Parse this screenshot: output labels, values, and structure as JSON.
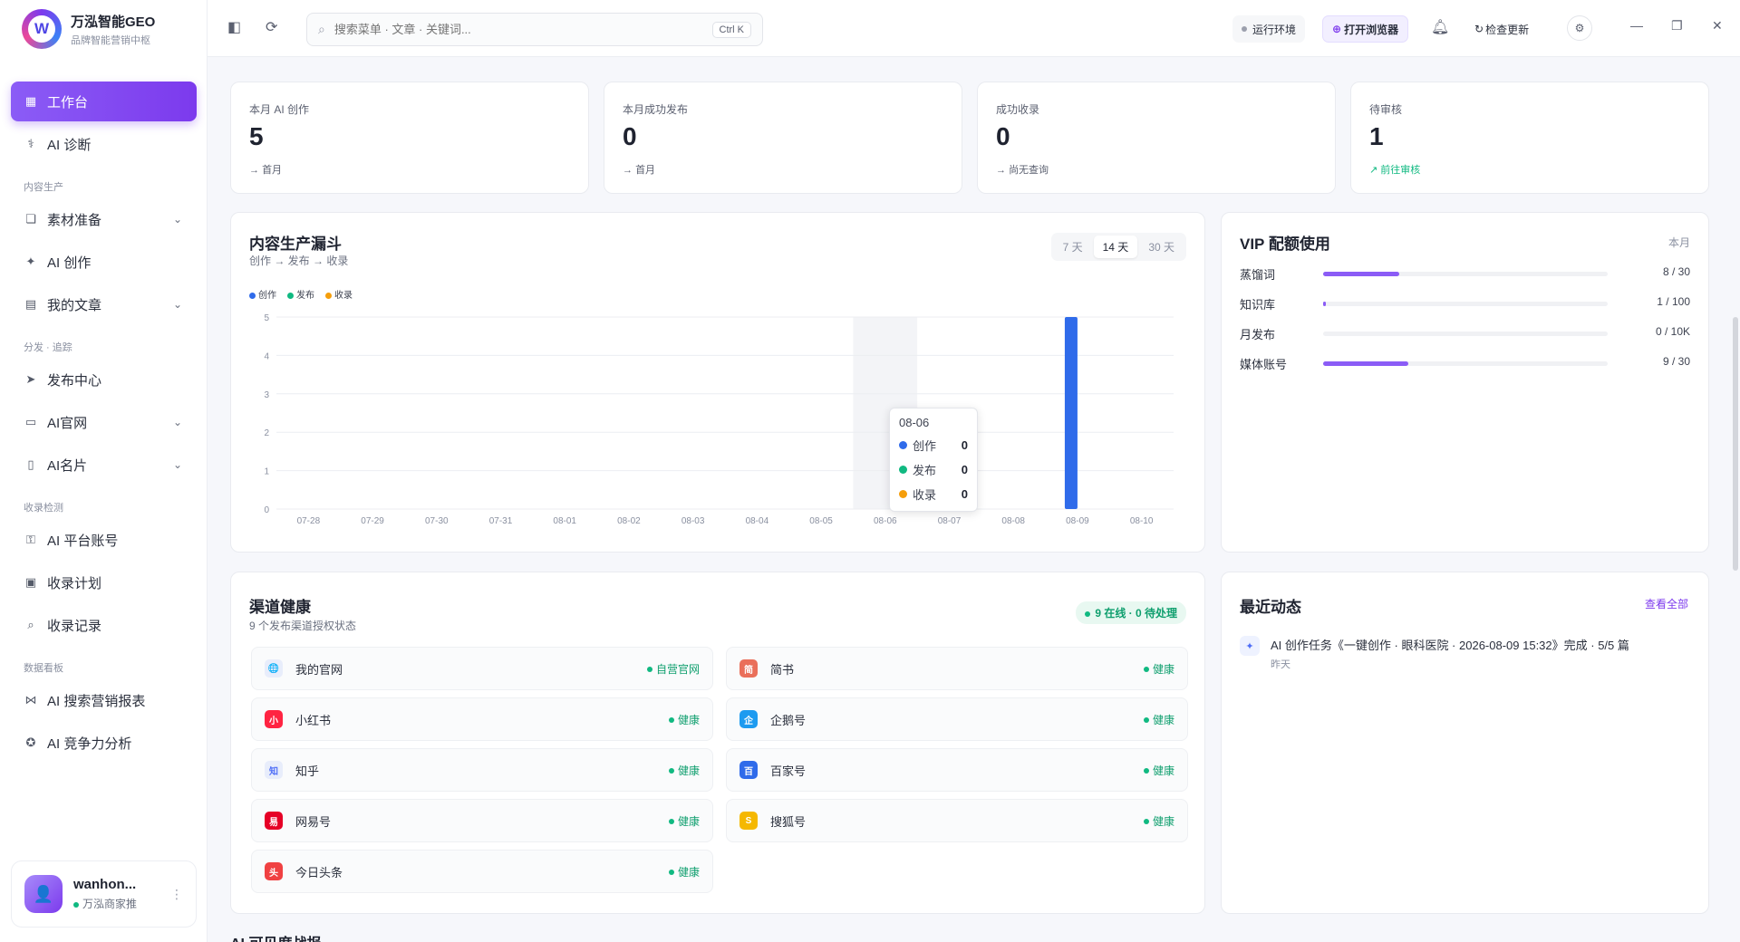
{
  "app": {
    "title": "万泓智能GEO",
    "subtitle": "品牌智能营销中枢",
    "logo_letter": "W"
  },
  "search": {
    "placeholder": "搜索菜单 · 文章 · 关键词...",
    "shortcut": "Ctrl K"
  },
  "topbar": {
    "env_label": "运行环境",
    "browser_label": "打开浏览器",
    "update_label": "检查更新"
  },
  "sidebar": {
    "items": [
      {
        "label": "工作台",
        "icon": "grid-icon",
        "active": true
      },
      {
        "label": "AI 诊断",
        "icon": "stethoscope-icon"
      }
    ],
    "sections": [
      {
        "title": "内容生产",
        "items": [
          {
            "label": "素材准备",
            "icon": "copy-icon",
            "chevron": true
          },
          {
            "label": "AI 创作",
            "icon": "sparkle-icon"
          },
          {
            "label": "我的文章",
            "icon": "document-icon",
            "chevron": true
          }
        ]
      },
      {
        "title": "分发 · 追踪",
        "items": [
          {
            "label": "发布中心",
            "icon": "send-icon"
          },
          {
            "label": "AI官网",
            "icon": "browser-icon",
            "chevron": true
          },
          {
            "label": "AI名片",
            "icon": "card-icon",
            "chevron": true
          }
        ]
      },
      {
        "title": "收录检测",
        "items": [
          {
            "label": "AI 平台账号",
            "icon": "key-icon"
          },
          {
            "label": "收录计划",
            "icon": "calendar-icon"
          },
          {
            "label": "收录记录",
            "icon": "search-doc-icon"
          }
        ]
      },
      {
        "title": "数据看板",
        "items": [
          {
            "label": "AI 搜索营销报表",
            "icon": "network-icon"
          },
          {
            "label": "AI 竞争力分析",
            "icon": "medal-icon"
          }
        ]
      }
    ]
  },
  "user": {
    "name": "wanhon...",
    "role": "万泓商家推"
  },
  "stats": [
    {
      "label": "本月 AI 创作",
      "value": "5",
      "sub": "首月"
    },
    {
      "label": "本月成功发布",
      "value": "0",
      "sub": "首月"
    },
    {
      "label": "成功收录",
      "value": "0",
      "sub": "尚无查询"
    },
    {
      "label": "待审核",
      "value": "1",
      "sub": "前往审核"
    }
  ],
  "funnel": {
    "title": "内容生产漏斗",
    "subtitle": "创作 → 发布 → 收录",
    "ranges": [
      "7 天",
      "14 天",
      "30 天"
    ],
    "active_range": "14 天"
  },
  "chart_data": {
    "type": "bar",
    "categories": [
      "07-28",
      "07-29",
      "07-30",
      "07-31",
      "08-01",
      "08-02",
      "08-03",
      "08-04",
      "08-05",
      "08-06",
      "08-07",
      "08-08",
      "08-09",
      "08-10"
    ],
    "series": [
      {
        "name": "创作",
        "color": "#2f6bea",
        "values": [
          0,
          0,
          0,
          0,
          0,
          0,
          0,
          0,
          0,
          0,
          0,
          0,
          5,
          0
        ]
      },
      {
        "name": "发布",
        "color": "#10b981",
        "values": [
          0,
          0,
          0,
          0,
          0,
          0,
          0,
          0,
          0,
          0,
          0,
          0,
          0,
          0
        ]
      },
      {
        "name": "收录",
        "color": "#f59e0b",
        "values": [
          0,
          0,
          0,
          0,
          0,
          0,
          0,
          0,
          0,
          0,
          0,
          0,
          0,
          0
        ]
      }
    ],
    "yticks": [
      0,
      1,
      2,
      3,
      4,
      5
    ],
    "ylim": [
      0,
      5
    ],
    "grid": true,
    "legend": "top-left",
    "tooltip": {
      "date": "08-06",
      "rows": [
        {
          "name": "创作",
          "value": "0"
        },
        {
          "name": "发布",
          "value": "0"
        },
        {
          "name": "收录",
          "value": "0"
        }
      ]
    }
  },
  "vip": {
    "title": "VIP 配额使用",
    "period": "本月",
    "rows": [
      {
        "name": "蒸馏词",
        "used": 8,
        "total": 30,
        "text": "8 / 30"
      },
      {
        "name": "知识库",
        "used": 1,
        "total": 100,
        "text": "1 / 100"
      },
      {
        "name": "月发布",
        "used": 0,
        "total": 10000,
        "text": "0 / 10K"
      },
      {
        "name": "媒体账号",
        "used": 9,
        "total": 30,
        "text": "9 / 30"
      }
    ]
  },
  "channels": {
    "title": "渠道健康",
    "subtitle": "9 个发布渠道授权状态",
    "badge": "9 在线 · 0 待处理",
    "items": [
      {
        "name": "我的官网",
        "status": "自营官网",
        "icon": "globe-icon",
        "color": "#e8edfb",
        "glyph": "🌐"
      },
      {
        "name": "简书",
        "status": "健康",
        "icon": "jianshu-icon",
        "color": "#ea6f5a",
        "glyph": "简"
      },
      {
        "name": "小红书",
        "status": "健康",
        "icon": "xiaohongshu-icon",
        "color": "#ff2442",
        "glyph": "小"
      },
      {
        "name": "企鹅号",
        "status": "健康",
        "icon": "penguin-icon",
        "color": "#1d9bf0",
        "glyph": "企"
      },
      {
        "name": "知乎",
        "status": "健康",
        "icon": "zhihu-icon",
        "color": "#e8edfb",
        "glyph": "知"
      },
      {
        "name": "百家号",
        "status": "健康",
        "icon": "baijiahao-icon",
        "color": "#2f6bea",
        "glyph": "百"
      },
      {
        "name": "网易号",
        "status": "健康",
        "icon": "netease-icon",
        "color": "#e60026",
        "glyph": "易"
      },
      {
        "name": "搜狐号",
        "status": "健康",
        "icon": "sohu-icon",
        "color": "#f5b800",
        "glyph": "S"
      },
      {
        "name": "今日头条",
        "status": "健康",
        "icon": "toutiao-icon",
        "color": "#f04142",
        "glyph": "头"
      }
    ]
  },
  "activity": {
    "title": "最近动态",
    "view_all": "查看全部",
    "items": [
      {
        "text": "AI 创作任务《一键创作 · 眼科医院 · 2026-08-09 15:32》完成 · 5/5 篇",
        "time": "昨天"
      }
    ]
  },
  "bottom_title": "AI 可见度战报"
}
